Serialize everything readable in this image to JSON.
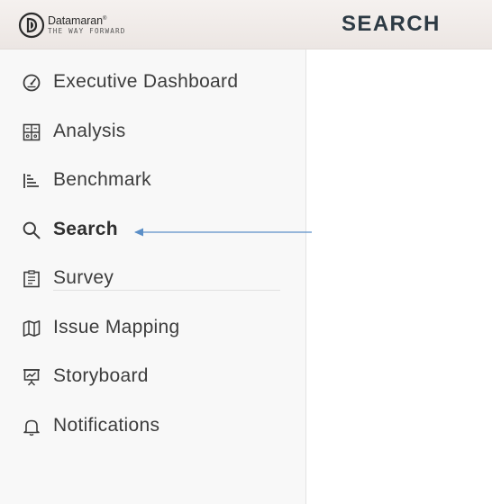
{
  "header": {
    "brand_name": "Datamaran",
    "brand_mark": "®",
    "brand_tagline": "THE WAY FORWARD",
    "page_title": "SEARCH"
  },
  "sidebar": {
    "items": [
      {
        "label": "Executive Dashboard",
        "icon": "gauge-icon",
        "active": false
      },
      {
        "label": "Analysis",
        "icon": "analysis-grid-icon",
        "active": false
      },
      {
        "label": "Benchmark",
        "icon": "benchmark-bars-icon",
        "active": false
      },
      {
        "label": "Search",
        "icon": "search-icon",
        "active": true
      },
      {
        "label": "Survey",
        "icon": "clipboard-icon",
        "active": false
      },
      {
        "label": "Issue Mapping",
        "icon": "map-icon",
        "active": false
      },
      {
        "label": "Storyboard",
        "icon": "presentation-board-icon",
        "active": false
      },
      {
        "label": "Notifications",
        "icon": "bell-icon",
        "active": false
      }
    ]
  },
  "annotation": {
    "color": "#5b8fc7",
    "points_to": "Search"
  },
  "colors": {
    "topbar": "#efe9e6",
    "sidebar": "#f8f8f8",
    "title": "#2d3a44",
    "text": "#3c3c3c"
  }
}
